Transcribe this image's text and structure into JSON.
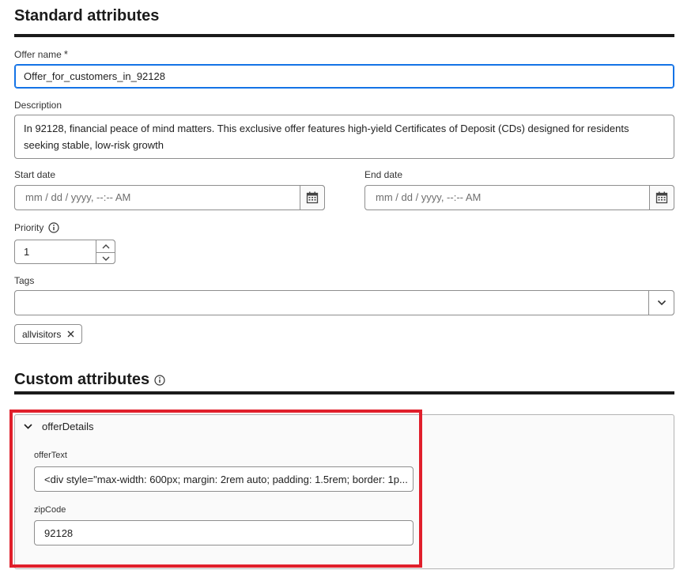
{
  "standard": {
    "title": "Standard attributes",
    "offer_name_label": "Offer name",
    "required_mark": "*",
    "offer_name_value": "Offer_for_customers_in_92128",
    "description_label": "Description",
    "description_value": "In 92128, financial peace of mind matters. This exclusive offer features high-yield Certificates of Deposit (CDs) designed for residents seeking stable, low-risk growth",
    "start_date_label": "Start date",
    "start_date_placeholder": "mm / dd / yyyy,  --:--  AM",
    "end_date_label": "End date",
    "end_date_placeholder": "mm / dd / yyyy,  --:--  AM",
    "priority_label": "Priority",
    "priority_value": "1",
    "tags_label": "Tags",
    "tag_chip": "allvisitors"
  },
  "custom": {
    "title": "Custom attributes",
    "group_label": "offerDetails",
    "offer_text_label": "offerText",
    "offer_text_value": "<div style=\"max-width: 600px; margin: 2rem auto; padding: 1.5rem; border: 1p...",
    "zip_code_label": "zipCode",
    "zip_code_value": "92128"
  },
  "icons": {
    "calendar": "calendar-icon",
    "info": "info-icon",
    "chevron_down": "chevron-down-icon",
    "close": "close-icon"
  },
  "colors": {
    "focus": "#1473e6",
    "highlight": "#e01f2b",
    "rule": "#1b1b1b"
  }
}
